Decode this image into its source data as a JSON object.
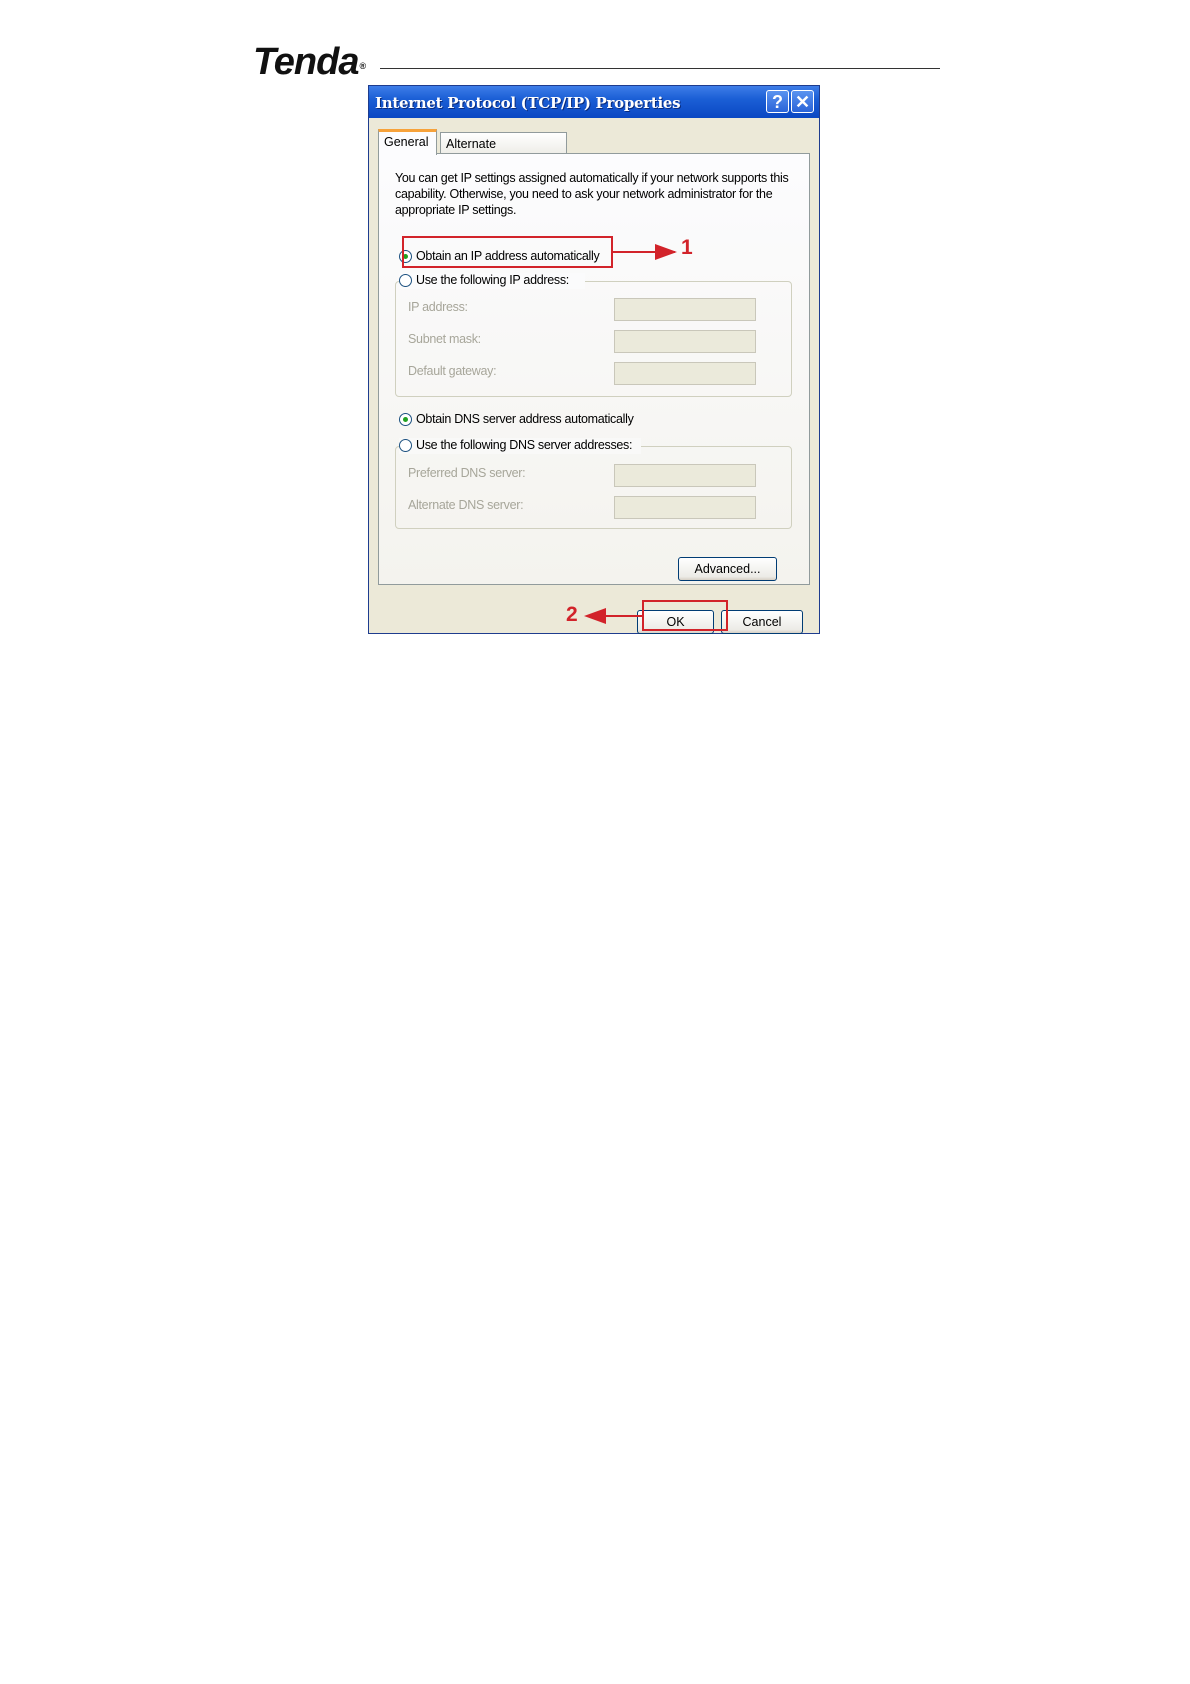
{
  "header": {
    "brand": "Tenda",
    "registered_mark": "®"
  },
  "dialog": {
    "title": "Internet Protocol (TCP/IP) Properties",
    "help_glyph": "?",
    "close_glyph": "✕",
    "tabs": [
      {
        "label": "General"
      },
      {
        "label": "Alternate Configuration"
      }
    ],
    "intro": "You can get IP settings assigned automatically if your network supports this capability. Otherwise, you need to ask your network administrator for the appropriate IP settings.",
    "ip_auto_label": "Obtain an IP address automatically",
    "ip_manual_label": "Use the following IP address:",
    "ip_fields": [
      {
        "label": "IP address:",
        "value": ""
      },
      {
        "label": "Subnet mask:",
        "value": ""
      },
      {
        "label": "Default gateway:",
        "value": ""
      }
    ],
    "dns_auto_label": "Obtain DNS server address automatically",
    "dns_manual_label": "Use the following DNS server addresses:",
    "dns_fields": [
      {
        "label": "Preferred DNS server:",
        "value": ""
      },
      {
        "label": "Alternate DNS server:",
        "value": ""
      }
    ],
    "advanced_label": "Advanced...",
    "ok_label": "OK",
    "cancel_label": "Cancel",
    "selected": {
      "ip": "auto",
      "dns": "auto"
    }
  },
  "annotations": {
    "step1": "1",
    "step2": "2",
    "color": "#d2232a"
  }
}
